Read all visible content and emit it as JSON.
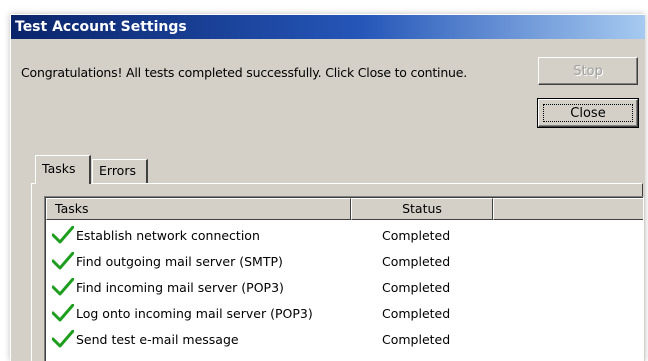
{
  "window": {
    "title": "Test Account Settings"
  },
  "message": "Congratulations! All tests completed successfully. Click Close to continue.",
  "buttons": {
    "stop_label": "Stop",
    "close_label": "Close"
  },
  "tabs": [
    {
      "label": "Tasks",
      "selected": true
    },
    {
      "label": "Errors",
      "selected": false
    }
  ],
  "table": {
    "columns": [
      "Tasks",
      "Status"
    ],
    "rows": [
      {
        "icon": "checkmark-icon",
        "task": "Establish network connection",
        "status": "Completed"
      },
      {
        "icon": "checkmark-icon",
        "task": "Find outgoing mail server (SMTP)",
        "status": "Completed"
      },
      {
        "icon": "checkmark-icon",
        "task": "Find incoming mail server (POP3)",
        "status": "Completed"
      },
      {
        "icon": "checkmark-icon",
        "task": "Log onto incoming mail server (POP3)",
        "status": "Completed"
      },
      {
        "icon": "checkmark-icon",
        "task": "Send test e-mail message",
        "status": "Completed"
      }
    ]
  },
  "colors": {
    "title_gradient_start": "#0a246a",
    "title_gradient_end": "#a6caf0",
    "window_face": "#d4d0c8",
    "checkmark": "#1e9e1e"
  }
}
